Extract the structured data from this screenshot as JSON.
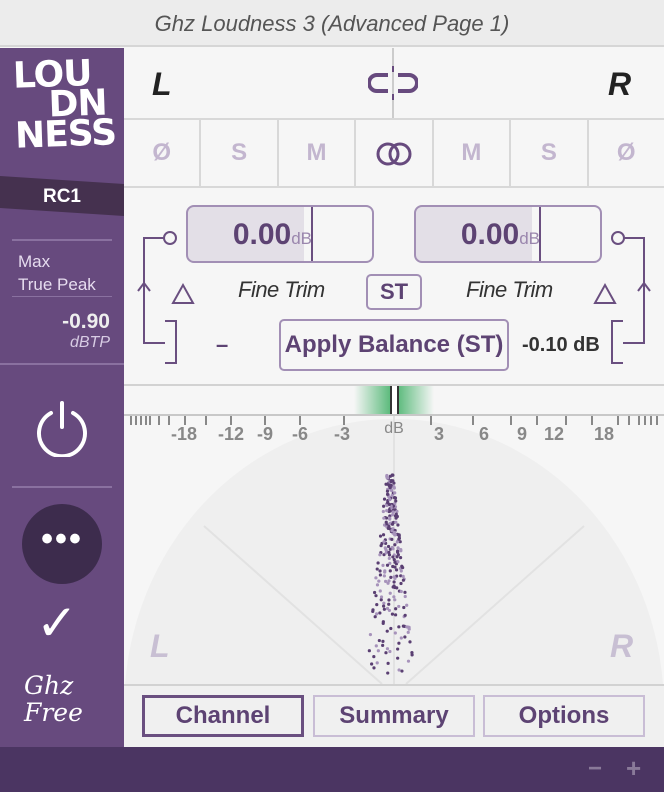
{
  "title": "Ghz Loudness 3 (Advanced Page 1)",
  "sidebar": {
    "logo": "LOUDNESS",
    "preset": "RC1",
    "max_true_peak_label": [
      "Max",
      "True Peak"
    ],
    "max_true_peak_value": "-0.90",
    "max_true_peak_unit": "dBTP",
    "more_label": "•••",
    "brand": [
      "Ghz",
      "Free"
    ]
  },
  "header": {
    "left": "L",
    "right": "R",
    "link_icon": "unlink-icon"
  },
  "channel_buttons": [
    "Ø",
    "S",
    "M",
    "∞",
    "M",
    "S",
    "Ø"
  ],
  "trim": {
    "left_value": "0.00",
    "right_value": "0.00",
    "unit": "dB",
    "left_label": "Fine Trim",
    "right_label": "Fine Trim",
    "st_label": "ST",
    "balance_minus": "–",
    "apply_balance": "Apply Balance (ST)",
    "balance_value": "-0.10 dB"
  },
  "scale": {
    "ticks": [
      "-18",
      "-12",
      "-9",
      "-6",
      "-3",
      "dB",
      "3",
      "6",
      "9",
      "12",
      "18"
    ]
  },
  "scope": {
    "left": "L",
    "right": "R"
  },
  "tabs": [
    "Channel",
    "Summary",
    "Options"
  ],
  "active_tab": "Channel",
  "bottom": {
    "minus": "−",
    "plus": "+"
  },
  "colors": {
    "accent": "#674a7e",
    "dark": "#4b3562",
    "meter_green": "#5dbb7d"
  }
}
